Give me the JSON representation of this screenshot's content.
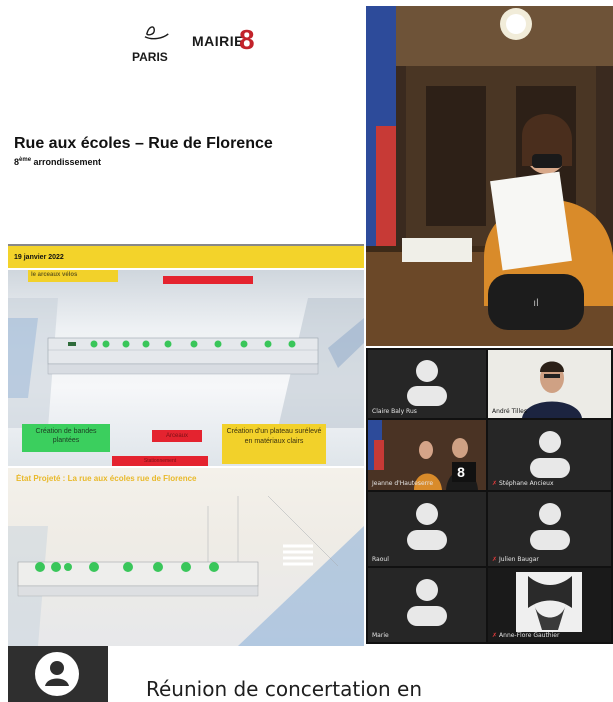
{
  "slide": {
    "paris_label": "PARIS",
    "mairie_label": "MAIRIE",
    "mairie_number": "8",
    "title": "Rue aux écoles – Rue de Florence",
    "subtitle_num": "8",
    "subtitle_sup": "ème",
    "subtitle_rest": " arrondissement",
    "date": "19 janvier 2022"
  },
  "plan_top": {
    "header_label": "le arceaux vélos",
    "labels": {
      "bandes": "Création de bandes plantées",
      "arceaux": "Arceaux",
      "plateau": "Création d'un plateau surélevé en matériaux clairs",
      "stationnement": "Stationnement"
    }
  },
  "plan_bottom": {
    "header_label": "État Projeté : La rue aux écoles rue de Florence"
  },
  "participants": [
    {
      "name": "Claire Baly Rus",
      "type": "avatar"
    },
    {
      "name": "André Tilles",
      "type": "video"
    },
    {
      "name": "Jeanne d'Hauteserre",
      "type": "video-room"
    },
    {
      "name": "Stéphane Ancieux",
      "type": "avatar"
    },
    {
      "name": "Raoul",
      "type": "avatar"
    },
    {
      "name": "Julien Baugar",
      "type": "avatar"
    },
    {
      "name": "Marie",
      "type": "avatar"
    },
    {
      "name": "Anne-Flore Gauthier",
      "type": "photo"
    }
  ],
  "room_badge": "8",
  "caption": "Réunion de concertation en",
  "colors": {
    "accent_yellow": "#f3d32a",
    "mairie_red": "#c2222a",
    "plan_green_label": "#3bcf5e",
    "plan_red_label": "#e4232f",
    "plan_yellow_label": "#f2d12a"
  }
}
